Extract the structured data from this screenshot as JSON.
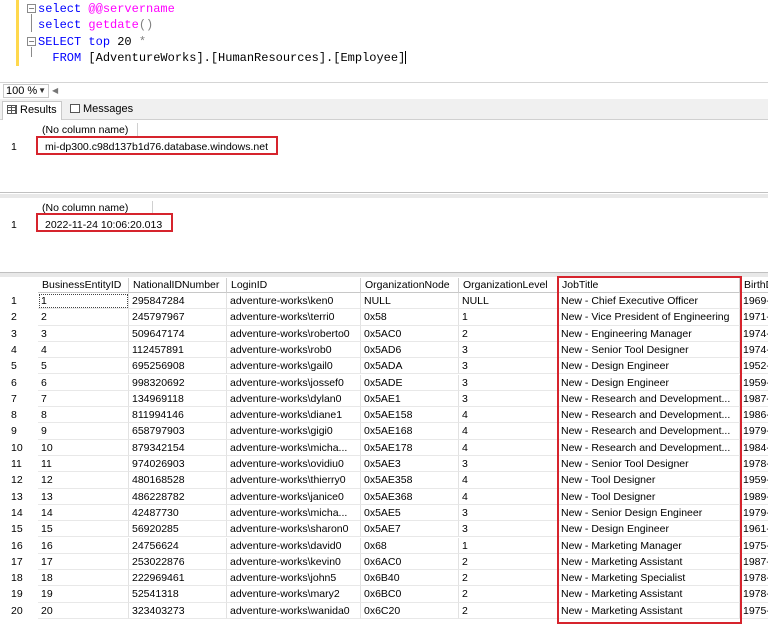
{
  "editor": {
    "lines": [
      {
        "prefix": "",
        "kw": "select",
        "rest": " @@servername"
      },
      {
        "prefix": "",
        "kw": "select",
        "fn": "getdate",
        "rest": "()"
      },
      {
        "prefix": "",
        "kw": "SELECT",
        "kw2": "top",
        "rest": " 20 ",
        "op": "*"
      },
      {
        "prefix": "  ",
        "kw": "FROM",
        "rest": " [AdventureWorks].[HumanResources].[Employee]"
      }
    ]
  },
  "zoom": {
    "value": "100 %"
  },
  "tabs": {
    "results": "Results",
    "messages": "Messages"
  },
  "result1": {
    "header": "(No column name)",
    "row_number": "1",
    "value": "mi-dp300.c98d137b1d76.database.windows.net"
  },
  "result2": {
    "header": "(No column name)",
    "row_number": "1",
    "value": "2022-11-24 10:06:20.013"
  },
  "employees": {
    "columns": [
      "BusinessEntityID",
      "NationalIDNumber",
      "LoginID",
      "OrganizationNode",
      "OrganizationLevel",
      "JobTitle",
      "BirthD"
    ],
    "rows": [
      [
        "1",
        "1",
        "295847284",
        "adventure-works\\ken0",
        "NULL",
        "NULL",
        "New - Chief Executive Officer",
        "1969-"
      ],
      [
        "2",
        "2",
        "245797967",
        "adventure-works\\terri0",
        "0x58",
        "1",
        "New - Vice President of Engineering",
        "1971-"
      ],
      [
        "3",
        "3",
        "509647174",
        "adventure-works\\roberto0",
        "0x5AC0",
        "2",
        "New - Engineering Manager",
        "1974-"
      ],
      [
        "4",
        "4",
        "112457891",
        "adventure-works\\rob0",
        "0x5AD6",
        "3",
        "New - Senior Tool Designer",
        "1974-"
      ],
      [
        "5",
        "5",
        "695256908",
        "adventure-works\\gail0",
        "0x5ADA",
        "3",
        "New - Design Engineer",
        "1952-"
      ],
      [
        "6",
        "6",
        "998320692",
        "adventure-works\\jossef0",
        "0x5ADE",
        "3",
        "New - Design Engineer",
        "1959-"
      ],
      [
        "7",
        "7",
        "134969118",
        "adventure-works\\dylan0",
        "0x5AE1",
        "3",
        "New - Research and Development...",
        "1987-"
      ],
      [
        "8",
        "8",
        "811994146",
        "adventure-works\\diane1",
        "0x5AE158",
        "4",
        "New - Research and Development...",
        "1986-"
      ],
      [
        "9",
        "9",
        "658797903",
        "adventure-works\\gigi0",
        "0x5AE168",
        "4",
        "New - Research and Development...",
        "1979-"
      ],
      [
        "10",
        "10",
        "879342154",
        "adventure-works\\micha...",
        "0x5AE178",
        "4",
        "New - Research and Development...",
        "1984-"
      ],
      [
        "11",
        "11",
        "974026903",
        "adventure-works\\ovidiu0",
        "0x5AE3",
        "3",
        "New - Senior Tool Designer",
        "1978-"
      ],
      [
        "12",
        "12",
        "480168528",
        "adventure-works\\thierry0",
        "0x5AE358",
        "4",
        "New - Tool Designer",
        "1959-"
      ],
      [
        "13",
        "13",
        "486228782",
        "adventure-works\\janice0",
        "0x5AE368",
        "4",
        "New - Tool Designer",
        "1989-"
      ],
      [
        "14",
        "14",
        "42487730",
        "adventure-works\\micha...",
        "0x5AE5",
        "3",
        "New - Senior Design Engineer",
        "1979-"
      ],
      [
        "15",
        "15",
        "56920285",
        "adventure-works\\sharon0",
        "0x5AE7",
        "3",
        "New - Design Engineer",
        "1961-"
      ],
      [
        "16",
        "16",
        "24756624",
        "adventure-works\\david0",
        "0x68",
        "1",
        "New - Marketing Manager",
        "1975-"
      ],
      [
        "17",
        "17",
        "253022876",
        "adventure-works\\kevin0",
        "0x6AC0",
        "2",
        "New - Marketing Assistant",
        "1987-"
      ],
      [
        "18",
        "18",
        "222969461",
        "adventure-works\\john5",
        "0x6B40",
        "2",
        "New - Marketing Specialist",
        "1978-"
      ],
      [
        "19",
        "19",
        "52541318",
        "adventure-works\\mary2",
        "0x6BC0",
        "2",
        "New - Marketing Assistant",
        "1978-"
      ],
      [
        "20",
        "20",
        "323403273",
        "adventure-works\\wanida0",
        "0x6C20",
        "2",
        "New - Marketing Assistant",
        "1975-"
      ]
    ]
  },
  "colors": {
    "highlight": "#d6242d",
    "keyword": "#0000ff",
    "function": "#ff00ff"
  }
}
